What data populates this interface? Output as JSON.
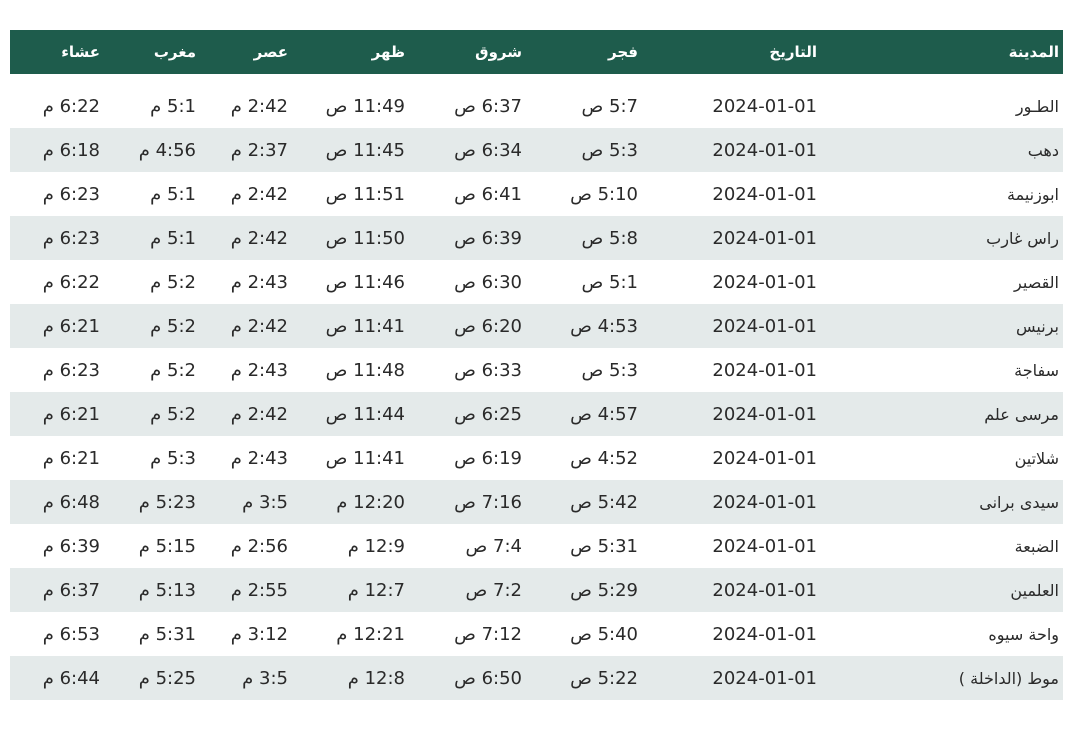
{
  "colors": {
    "header_bg": "#1e5c4c",
    "header_text": "#ffffff",
    "row_alt": "#e4eaea",
    "text": "#2a2a2a"
  },
  "table": {
    "headers": {
      "city": "المدينة",
      "date": "التاريخ",
      "fajr": "فجر",
      "shurooq": "شروق",
      "dhuhr": "ظهر",
      "asr": "عصر",
      "maghrib": "مغرب",
      "isha": "عشاء"
    },
    "rows": [
      {
        "city": "الطـور",
        "date": "2024-01-01",
        "fajr": "5:7 ص",
        "shurooq": "6:37 ص",
        "dhuhr": "11:49 ص",
        "asr": "2:42 م",
        "maghrib": "5:1 م",
        "isha": "6:22 م"
      },
      {
        "city": "دهب",
        "date": "2024-01-01",
        "fajr": "5:3 ص",
        "shurooq": "6:34 ص",
        "dhuhr": "11:45 ص",
        "asr": "2:37 م",
        "maghrib": "4:56 م",
        "isha": "6:18 م"
      },
      {
        "city": "ابوزنيمة",
        "date": "2024-01-01",
        "fajr": "5:10 ص",
        "shurooq": "6:41 ص",
        "dhuhr": "11:51 ص",
        "asr": "2:42 م",
        "maghrib": "5:1 م",
        "isha": "6:23 م"
      },
      {
        "city": "راس غارب",
        "date": "2024-01-01",
        "fajr": "5:8 ص",
        "shurooq": "6:39 ص",
        "dhuhr": "11:50 ص",
        "asr": "2:42 م",
        "maghrib": "5:1 م",
        "isha": "6:23 م"
      },
      {
        "city": "القصير",
        "date": "2024-01-01",
        "fajr": "5:1 ص",
        "shurooq": "6:30 ص",
        "dhuhr": "11:46 ص",
        "asr": "2:43 م",
        "maghrib": "5:2 م",
        "isha": "6:22 م"
      },
      {
        "city": "برنيس",
        "date": "2024-01-01",
        "fajr": "4:53 ص",
        "shurooq": "6:20 ص",
        "dhuhr": "11:41 ص",
        "asr": "2:42 م",
        "maghrib": "5:2 م",
        "isha": "6:21 م"
      },
      {
        "city": "سفاجة",
        "date": "2024-01-01",
        "fajr": "5:3 ص",
        "shurooq": "6:33 ص",
        "dhuhr": "11:48 ص",
        "asr": "2:43 م",
        "maghrib": "5:2 م",
        "isha": "6:23 م"
      },
      {
        "city": "مرسى علم",
        "date": "2024-01-01",
        "fajr": "4:57 ص",
        "shurooq": "6:25 ص",
        "dhuhr": "11:44 ص",
        "asr": "2:42 م",
        "maghrib": "5:2 م",
        "isha": "6:21 م"
      },
      {
        "city": "شلاتين",
        "date": "2024-01-01",
        "fajr": "4:52 ص",
        "shurooq": "6:19 ص",
        "dhuhr": "11:41 ص",
        "asr": "2:43 م",
        "maghrib": "5:3 م",
        "isha": "6:21 م"
      },
      {
        "city": "سيدى برانى",
        "date": "2024-01-01",
        "fajr": "5:42 ص",
        "shurooq": "7:16 ص",
        "dhuhr": "12:20 م",
        "asr": "3:5 م",
        "maghrib": "5:23 م",
        "isha": "6:48 م"
      },
      {
        "city": "الضبعة",
        "date": "2024-01-01",
        "fajr": "5:31 ص",
        "shurooq": "7:4 ص",
        "dhuhr": "12:9 م",
        "asr": "2:56 م",
        "maghrib": "5:15 م",
        "isha": "6:39 م"
      },
      {
        "city": "العلمين",
        "date": "2024-01-01",
        "fajr": "5:29 ص",
        "shurooq": "7:2 ص",
        "dhuhr": "12:7 م",
        "asr": "2:55 م",
        "maghrib": "5:13 م",
        "isha": "6:37 م"
      },
      {
        "city": "واحة سيوه",
        "date": "2024-01-01",
        "fajr": "5:40 ص",
        "shurooq": "7:12 ص",
        "dhuhr": "12:21 م",
        "asr": "3:12 م",
        "maghrib": "5:31 م",
        "isha": "6:53 م"
      },
      {
        "city": "موط (الداخلة )",
        "date": "2024-01-01",
        "fajr": "5:22 ص",
        "shurooq": "6:50 ص",
        "dhuhr": "12:8 م",
        "asr": "3:5 م",
        "maghrib": "5:25 م",
        "isha": "6:44 م"
      }
    ]
  }
}
